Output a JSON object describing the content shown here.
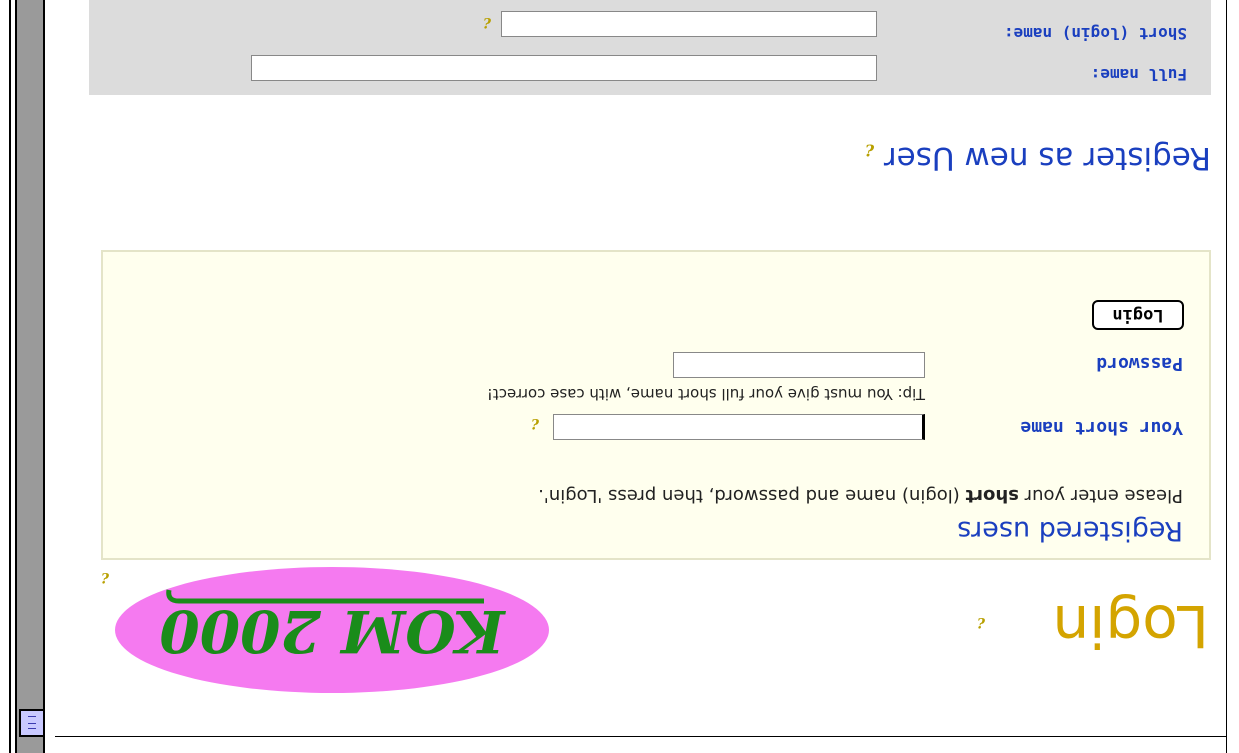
{
  "page": {
    "title": "Login",
    "logo_text": "KOM 2000"
  },
  "login": {
    "heading": "Registered users",
    "instructions_prefix": "Please enter your ",
    "instructions_bold": "short",
    "instructions_suffix": " (login) name and password, then press 'Login'.",
    "short_name_label": "Your short name",
    "short_name_value": "",
    "tip": "Tip: You must give your full short name, with case correct!",
    "password_label": "Password",
    "password_value": "",
    "login_button": "Login"
  },
  "register": {
    "heading": "Register as new User",
    "full_name_label": "Full name:",
    "full_name_value": "",
    "short_name_label": "Short (login) name:",
    "short_name_value": ""
  },
  "icons": {
    "help": "help-icon",
    "scroll": "scroll-thumb-lines-icon"
  },
  "colors": {
    "title": "#d4a400",
    "heading": "#1a3fbf",
    "logo_ellipse": "#f57af0",
    "logo_text": "#1a8c1a",
    "panel_bg": "#ffffee",
    "register_bg": "#dcdcdc"
  },
  "help_glyph": "¿"
}
